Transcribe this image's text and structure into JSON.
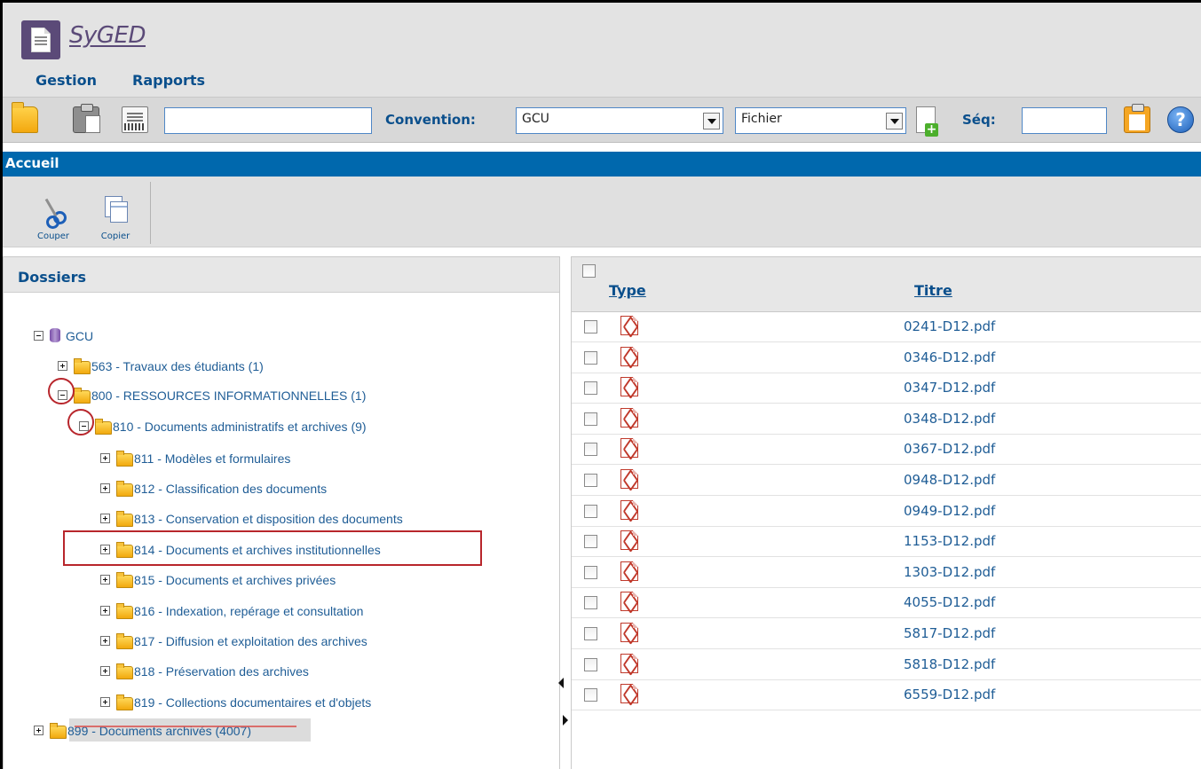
{
  "app": {
    "name": "SyGED",
    "logo_icon": "document-logo-icon"
  },
  "menu": {
    "items": [
      "Gestion",
      "Rapports"
    ]
  },
  "toolbar": {
    "search_value": "",
    "convention_label": "Convention:",
    "convention_value": "GCU",
    "type_value": "Fichier",
    "seq_label": "Séq:",
    "seq_value": "",
    "icons": [
      "folder-icon",
      "clipboard-scan-icon",
      "scanner-icon",
      "new-document-icon",
      "paste-clipboard-icon",
      "help-icon"
    ]
  },
  "page": {
    "title": "Accueil"
  },
  "actions": [
    {
      "label": "Couper",
      "icon": "scissors-icon"
    },
    {
      "label": "Copier",
      "icon": "copy-icon"
    }
  ],
  "folders": {
    "title": "Dossiers",
    "root": "GCU",
    "nodes": [
      {
        "label": "563 - Travaux des étudiants (1)",
        "expanded": false
      },
      {
        "label": "800 - RESSOURCES INFORMATIONNELLES (1)",
        "expanded": true
      },
      {
        "label": "810 - Documents administratifs et archives (9)",
        "expanded": true
      },
      {
        "label": "811 - Modèles et formulaires",
        "expanded": false
      },
      {
        "label": "812 - Classification des documents",
        "expanded": false
      },
      {
        "label": "813 - Conservation et disposition des documents",
        "expanded": false
      },
      {
        "label": "814 - Documents et archives institutionnelles",
        "expanded": false
      },
      {
        "label": "815 - Documents et archives privées",
        "expanded": false
      },
      {
        "label": "816 - Indexation, repérage et consultation",
        "expanded": false
      },
      {
        "label": "817 - Diffusion et exploitation des archives",
        "expanded": false
      },
      {
        "label": "818 - Préservation des archives",
        "expanded": false
      },
      {
        "label": "819 - Collections documentaires et d'objets",
        "expanded": false
      },
      {
        "label": "899 - Documents archivés (4007)",
        "expanded": false
      }
    ]
  },
  "documents": {
    "columns": [
      "Type",
      "Titre"
    ],
    "file_icon": "pdf-icon",
    "rows": [
      "0241-D12.pdf",
      "0346-D12.pdf",
      "0347-D12.pdf",
      "0348-D12.pdf",
      "0367-D12.pdf",
      "0948-D12.pdf",
      "0949-D12.pdf",
      "1153-D12.pdf",
      "1303-D12.pdf",
      "4055-D12.pdf",
      "5817-D12.pdf",
      "5818-D12.pdf",
      "6559-D12.pdf"
    ]
  },
  "colors": {
    "brand": "#5b4a78",
    "accent_bar": "#0068ad",
    "link": "#1f5d96",
    "annotation": "#b8262c"
  }
}
